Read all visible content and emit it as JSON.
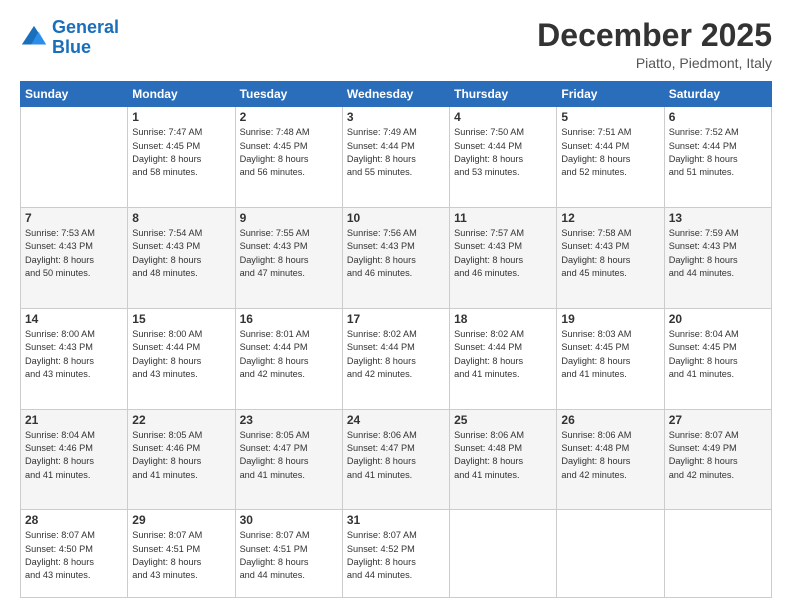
{
  "header": {
    "logo_general": "General",
    "logo_blue": "Blue",
    "month": "December 2025",
    "location": "Piatto, Piedmont, Italy"
  },
  "days_of_week": [
    "Sunday",
    "Monday",
    "Tuesday",
    "Wednesday",
    "Thursday",
    "Friday",
    "Saturday"
  ],
  "weeks": [
    {
      "cells": [
        {
          "day": null,
          "data": null
        },
        {
          "day": "1",
          "data": "Sunrise: 7:47 AM\nSunset: 4:45 PM\nDaylight: 8 hours\nand 58 minutes."
        },
        {
          "day": "2",
          "data": "Sunrise: 7:48 AM\nSunset: 4:45 PM\nDaylight: 8 hours\nand 56 minutes."
        },
        {
          "day": "3",
          "data": "Sunrise: 7:49 AM\nSunset: 4:44 PM\nDaylight: 8 hours\nand 55 minutes."
        },
        {
          "day": "4",
          "data": "Sunrise: 7:50 AM\nSunset: 4:44 PM\nDaylight: 8 hours\nand 53 minutes."
        },
        {
          "day": "5",
          "data": "Sunrise: 7:51 AM\nSunset: 4:44 PM\nDaylight: 8 hours\nand 52 minutes."
        },
        {
          "day": "6",
          "data": "Sunrise: 7:52 AM\nSunset: 4:44 PM\nDaylight: 8 hours\nand 51 minutes."
        }
      ]
    },
    {
      "cells": [
        {
          "day": "7",
          "data": "Sunrise: 7:53 AM\nSunset: 4:43 PM\nDaylight: 8 hours\nand 50 minutes."
        },
        {
          "day": "8",
          "data": "Sunrise: 7:54 AM\nSunset: 4:43 PM\nDaylight: 8 hours\nand 48 minutes."
        },
        {
          "day": "9",
          "data": "Sunrise: 7:55 AM\nSunset: 4:43 PM\nDaylight: 8 hours\nand 47 minutes."
        },
        {
          "day": "10",
          "data": "Sunrise: 7:56 AM\nSunset: 4:43 PM\nDaylight: 8 hours\nand 46 minutes."
        },
        {
          "day": "11",
          "data": "Sunrise: 7:57 AM\nSunset: 4:43 PM\nDaylight: 8 hours\nand 46 minutes."
        },
        {
          "day": "12",
          "data": "Sunrise: 7:58 AM\nSunset: 4:43 PM\nDaylight: 8 hours\nand 45 minutes."
        },
        {
          "day": "13",
          "data": "Sunrise: 7:59 AM\nSunset: 4:43 PM\nDaylight: 8 hours\nand 44 minutes."
        }
      ]
    },
    {
      "cells": [
        {
          "day": "14",
          "data": "Sunrise: 8:00 AM\nSunset: 4:43 PM\nDaylight: 8 hours\nand 43 minutes."
        },
        {
          "day": "15",
          "data": "Sunrise: 8:00 AM\nSunset: 4:44 PM\nDaylight: 8 hours\nand 43 minutes."
        },
        {
          "day": "16",
          "data": "Sunrise: 8:01 AM\nSunset: 4:44 PM\nDaylight: 8 hours\nand 42 minutes."
        },
        {
          "day": "17",
          "data": "Sunrise: 8:02 AM\nSunset: 4:44 PM\nDaylight: 8 hours\nand 42 minutes."
        },
        {
          "day": "18",
          "data": "Sunrise: 8:02 AM\nSunset: 4:44 PM\nDaylight: 8 hours\nand 41 minutes."
        },
        {
          "day": "19",
          "data": "Sunrise: 8:03 AM\nSunset: 4:45 PM\nDaylight: 8 hours\nand 41 minutes."
        },
        {
          "day": "20",
          "data": "Sunrise: 8:04 AM\nSunset: 4:45 PM\nDaylight: 8 hours\nand 41 minutes."
        }
      ]
    },
    {
      "cells": [
        {
          "day": "21",
          "data": "Sunrise: 8:04 AM\nSunset: 4:46 PM\nDaylight: 8 hours\nand 41 minutes."
        },
        {
          "day": "22",
          "data": "Sunrise: 8:05 AM\nSunset: 4:46 PM\nDaylight: 8 hours\nand 41 minutes."
        },
        {
          "day": "23",
          "data": "Sunrise: 8:05 AM\nSunset: 4:47 PM\nDaylight: 8 hours\nand 41 minutes."
        },
        {
          "day": "24",
          "data": "Sunrise: 8:06 AM\nSunset: 4:47 PM\nDaylight: 8 hours\nand 41 minutes."
        },
        {
          "day": "25",
          "data": "Sunrise: 8:06 AM\nSunset: 4:48 PM\nDaylight: 8 hours\nand 41 minutes."
        },
        {
          "day": "26",
          "data": "Sunrise: 8:06 AM\nSunset: 4:48 PM\nDaylight: 8 hours\nand 42 minutes."
        },
        {
          "day": "27",
          "data": "Sunrise: 8:07 AM\nSunset: 4:49 PM\nDaylight: 8 hours\nand 42 minutes."
        }
      ]
    },
    {
      "cells": [
        {
          "day": "28",
          "data": "Sunrise: 8:07 AM\nSunset: 4:50 PM\nDaylight: 8 hours\nand 43 minutes."
        },
        {
          "day": "29",
          "data": "Sunrise: 8:07 AM\nSunset: 4:51 PM\nDaylight: 8 hours\nand 43 minutes."
        },
        {
          "day": "30",
          "data": "Sunrise: 8:07 AM\nSunset: 4:51 PM\nDaylight: 8 hours\nand 44 minutes."
        },
        {
          "day": "31",
          "data": "Sunrise: 8:07 AM\nSunset: 4:52 PM\nDaylight: 8 hours\nand 44 minutes."
        },
        {
          "day": null,
          "data": null
        },
        {
          "day": null,
          "data": null
        },
        {
          "day": null,
          "data": null
        }
      ]
    }
  ]
}
